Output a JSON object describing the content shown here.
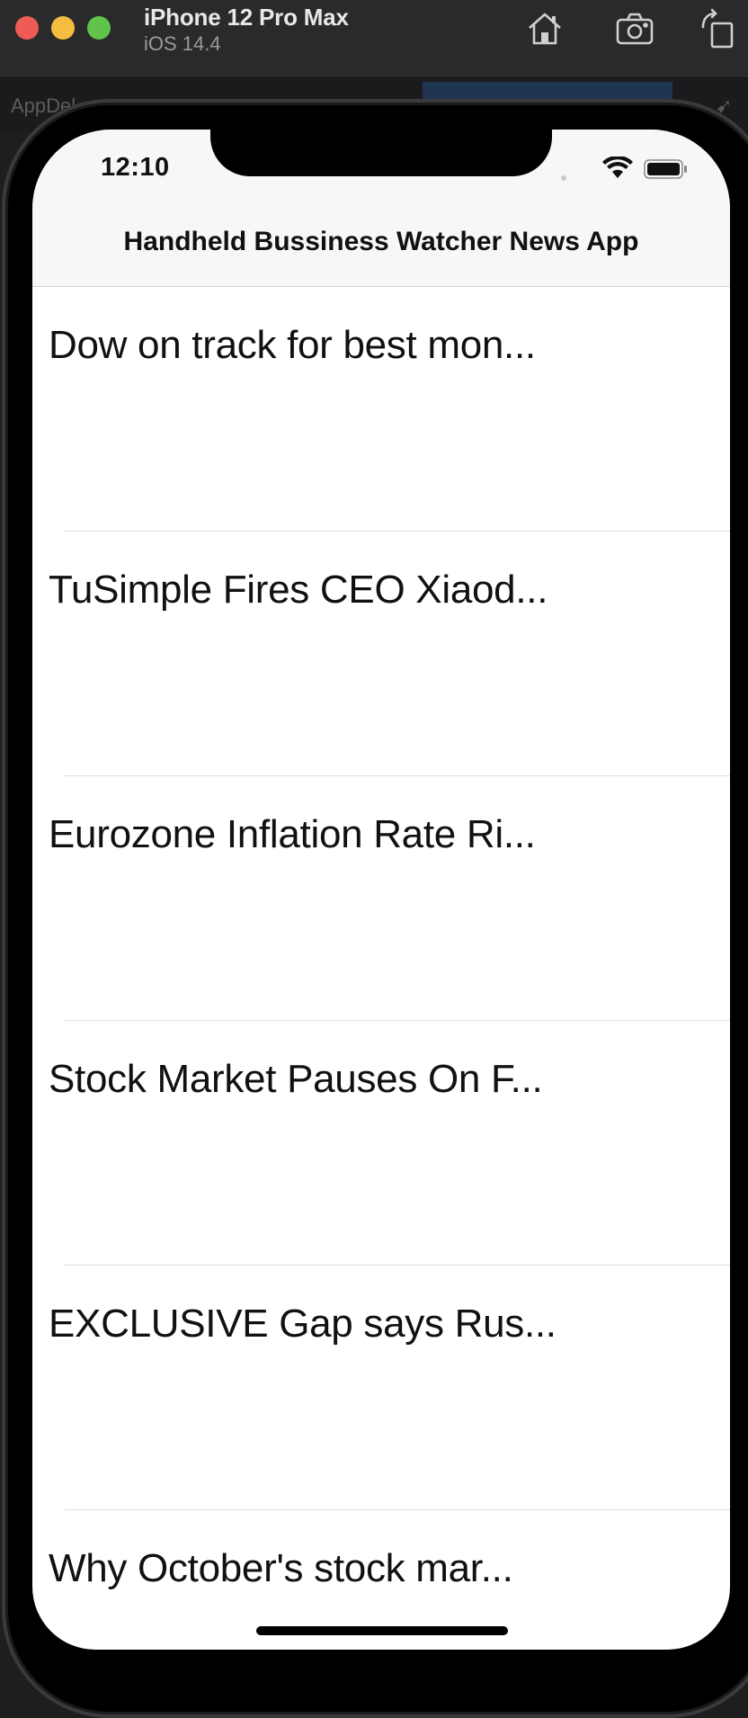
{
  "simulator": {
    "device_name": "iPhone 12 Pro Max",
    "os_version": "iOS 14.4",
    "toolbar_icons": [
      "home-icon",
      "screenshot-icon",
      "rotate-icon"
    ]
  },
  "xcode": {
    "tab_label": "AppDel"
  },
  "status_bar": {
    "time": "12:10"
  },
  "nav_bar": {
    "title": "Handheld Bussiness Watcher News App"
  },
  "news_items": [
    {
      "title": "Dow on track for best mon..."
    },
    {
      "title": "TuSimple Fires CEO Xiaod..."
    },
    {
      "title": "Eurozone Inflation Rate Ri..."
    },
    {
      "title": "Stock Market Pauses On F..."
    },
    {
      "title": "EXCLUSIVE Gap says Rus..."
    },
    {
      "title": "Why October's stock mar..."
    }
  ],
  "colors": {
    "close": "#ee5c55",
    "minimize": "#f5bd3f",
    "zoom": "#5fc449"
  }
}
